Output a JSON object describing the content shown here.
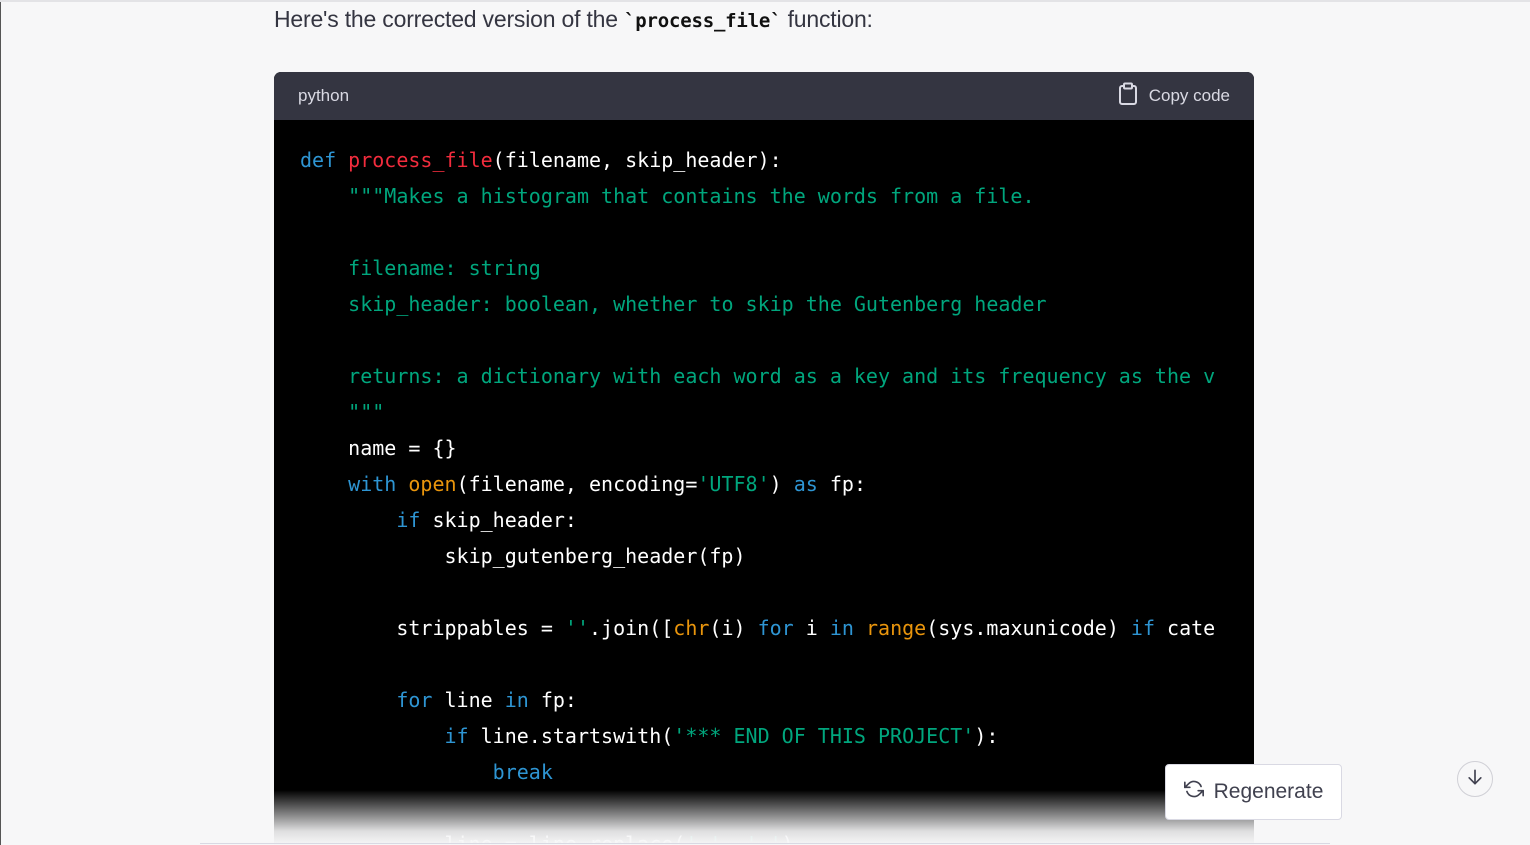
{
  "message": {
    "intro_before": "Here's the corrected version of the ",
    "intro_code": "`process_file`",
    "intro_after": " function:"
  },
  "code_block": {
    "language": "python",
    "copy_label": "Copy code",
    "copy_icon": "clipboard-icon",
    "lines": [
      [
        {
          "t": "def",
          "c": "kw"
        },
        {
          "t": " "
        },
        {
          "t": "process_file",
          "c": "fn"
        },
        {
          "t": "(filename, skip_header):"
        }
      ],
      [
        {
          "t": "    "
        },
        {
          "t": "\"\"\"Makes a histogram that contains the words from a file.",
          "c": "str"
        }
      ],
      [],
      [
        {
          "t": "    "
        },
        {
          "t": "filename: string",
          "c": "str"
        }
      ],
      [
        {
          "t": "    "
        },
        {
          "t": "skip_header: boolean, whether to skip the Gutenberg header",
          "c": "str"
        }
      ],
      [],
      [
        {
          "t": "    "
        },
        {
          "t": "returns: a dictionary with each word as a key and its frequency as the v",
          "c": "str"
        }
      ],
      [
        {
          "t": "    "
        },
        {
          "t": "\"\"\"",
          "c": "str"
        }
      ],
      [
        {
          "t": "    name = {}"
        }
      ],
      [
        {
          "t": "    "
        },
        {
          "t": "with",
          "c": "kw"
        },
        {
          "t": " "
        },
        {
          "t": "open",
          "c": "bi"
        },
        {
          "t": "(filename, encoding="
        },
        {
          "t": "'UTF8'",
          "c": "str"
        },
        {
          "t": ") "
        },
        {
          "t": "as",
          "c": "kw"
        },
        {
          "t": " fp:"
        }
      ],
      [
        {
          "t": "        "
        },
        {
          "t": "if",
          "c": "kw"
        },
        {
          "t": " skip_header:"
        }
      ],
      [
        {
          "t": "            skip_gutenberg_header(fp)"
        }
      ],
      [],
      [
        {
          "t": "        strippables = "
        },
        {
          "t": "''",
          "c": "str"
        },
        {
          "t": ".join(["
        },
        {
          "t": "chr",
          "c": "bi"
        },
        {
          "t": "(i) "
        },
        {
          "t": "for",
          "c": "kw"
        },
        {
          "t": " i "
        },
        {
          "t": "in",
          "c": "kw"
        },
        {
          "t": " "
        },
        {
          "t": "range",
          "c": "bi"
        },
        {
          "t": "(sys.maxunicode) "
        },
        {
          "t": "if",
          "c": "kw"
        },
        {
          "t": " cate"
        }
      ],
      [],
      [
        {
          "t": "        "
        },
        {
          "t": "for",
          "c": "kw"
        },
        {
          "t": " line "
        },
        {
          "t": "in",
          "c": "kw"
        },
        {
          "t": " fp:"
        }
      ],
      [
        {
          "t": "            "
        },
        {
          "t": "if",
          "c": "kw"
        },
        {
          "t": " line.startswith("
        },
        {
          "t": "'*** END OF THIS PROJECT'",
          "c": "str"
        },
        {
          "t": "):"
        }
      ],
      [
        {
          "t": "                "
        },
        {
          "t": "break",
          "c": "kw"
        }
      ],
      [],
      [
        {
          "t": "            line = line.replace("
        },
        {
          "t": "'-'",
          "c": "str"
        },
        {
          "t": ", "
        },
        {
          "t": "' '",
          "c": "str"
        },
        {
          "t": ")"
        }
      ]
    ]
  },
  "actions": {
    "regenerate_label": "Regenerate",
    "regenerate_icon": "refresh-icon",
    "scroll_icon": "arrow-down-icon"
  },
  "colors": {
    "keyword": "#2e95d3",
    "function": "#f22c3d",
    "string": "#00a67d",
    "builtin": "#e9950c",
    "code_bg": "#000000",
    "header_bg": "#343541"
  }
}
